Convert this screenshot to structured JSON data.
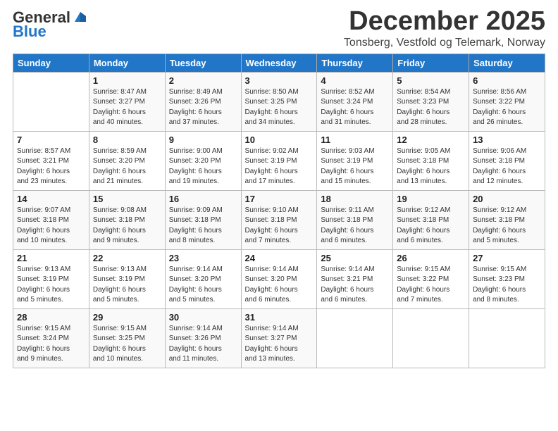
{
  "logo": {
    "general": "General",
    "blue": "Blue"
  },
  "header": {
    "month": "December 2025",
    "location": "Tonsberg, Vestfold og Telemark, Norway"
  },
  "weekdays": [
    "Sunday",
    "Monday",
    "Tuesday",
    "Wednesday",
    "Thursday",
    "Friday",
    "Saturday"
  ],
  "weeks": [
    [
      {
        "day": "",
        "info": ""
      },
      {
        "day": "1",
        "info": "Sunrise: 8:47 AM\nSunset: 3:27 PM\nDaylight: 6 hours\nand 40 minutes."
      },
      {
        "day": "2",
        "info": "Sunrise: 8:49 AM\nSunset: 3:26 PM\nDaylight: 6 hours\nand 37 minutes."
      },
      {
        "day": "3",
        "info": "Sunrise: 8:50 AM\nSunset: 3:25 PM\nDaylight: 6 hours\nand 34 minutes."
      },
      {
        "day": "4",
        "info": "Sunrise: 8:52 AM\nSunset: 3:24 PM\nDaylight: 6 hours\nand 31 minutes."
      },
      {
        "day": "5",
        "info": "Sunrise: 8:54 AM\nSunset: 3:23 PM\nDaylight: 6 hours\nand 28 minutes."
      },
      {
        "day": "6",
        "info": "Sunrise: 8:56 AM\nSunset: 3:22 PM\nDaylight: 6 hours\nand 26 minutes."
      }
    ],
    [
      {
        "day": "7",
        "info": "Sunrise: 8:57 AM\nSunset: 3:21 PM\nDaylight: 6 hours\nand 23 minutes."
      },
      {
        "day": "8",
        "info": "Sunrise: 8:59 AM\nSunset: 3:20 PM\nDaylight: 6 hours\nand 21 minutes."
      },
      {
        "day": "9",
        "info": "Sunrise: 9:00 AM\nSunset: 3:20 PM\nDaylight: 6 hours\nand 19 minutes."
      },
      {
        "day": "10",
        "info": "Sunrise: 9:02 AM\nSunset: 3:19 PM\nDaylight: 6 hours\nand 17 minutes."
      },
      {
        "day": "11",
        "info": "Sunrise: 9:03 AM\nSunset: 3:19 PM\nDaylight: 6 hours\nand 15 minutes."
      },
      {
        "day": "12",
        "info": "Sunrise: 9:05 AM\nSunset: 3:18 PM\nDaylight: 6 hours\nand 13 minutes."
      },
      {
        "day": "13",
        "info": "Sunrise: 9:06 AM\nSunset: 3:18 PM\nDaylight: 6 hours\nand 12 minutes."
      }
    ],
    [
      {
        "day": "14",
        "info": "Sunrise: 9:07 AM\nSunset: 3:18 PM\nDaylight: 6 hours\nand 10 minutes."
      },
      {
        "day": "15",
        "info": "Sunrise: 9:08 AM\nSunset: 3:18 PM\nDaylight: 6 hours\nand 9 minutes."
      },
      {
        "day": "16",
        "info": "Sunrise: 9:09 AM\nSunset: 3:18 PM\nDaylight: 6 hours\nand 8 minutes."
      },
      {
        "day": "17",
        "info": "Sunrise: 9:10 AM\nSunset: 3:18 PM\nDaylight: 6 hours\nand 7 minutes."
      },
      {
        "day": "18",
        "info": "Sunrise: 9:11 AM\nSunset: 3:18 PM\nDaylight: 6 hours\nand 6 minutes."
      },
      {
        "day": "19",
        "info": "Sunrise: 9:12 AM\nSunset: 3:18 PM\nDaylight: 6 hours\nand 6 minutes."
      },
      {
        "day": "20",
        "info": "Sunrise: 9:12 AM\nSunset: 3:18 PM\nDaylight: 6 hours\nand 5 minutes."
      }
    ],
    [
      {
        "day": "21",
        "info": "Sunrise: 9:13 AM\nSunset: 3:19 PM\nDaylight: 6 hours\nand 5 minutes."
      },
      {
        "day": "22",
        "info": "Sunrise: 9:13 AM\nSunset: 3:19 PM\nDaylight: 6 hours\nand 5 minutes."
      },
      {
        "day": "23",
        "info": "Sunrise: 9:14 AM\nSunset: 3:20 PM\nDaylight: 6 hours\nand 5 minutes."
      },
      {
        "day": "24",
        "info": "Sunrise: 9:14 AM\nSunset: 3:20 PM\nDaylight: 6 hours\nand 6 minutes."
      },
      {
        "day": "25",
        "info": "Sunrise: 9:14 AM\nSunset: 3:21 PM\nDaylight: 6 hours\nand 6 minutes."
      },
      {
        "day": "26",
        "info": "Sunrise: 9:15 AM\nSunset: 3:22 PM\nDaylight: 6 hours\nand 7 minutes."
      },
      {
        "day": "27",
        "info": "Sunrise: 9:15 AM\nSunset: 3:23 PM\nDaylight: 6 hours\nand 8 minutes."
      }
    ],
    [
      {
        "day": "28",
        "info": "Sunrise: 9:15 AM\nSunset: 3:24 PM\nDaylight: 6 hours\nand 9 minutes."
      },
      {
        "day": "29",
        "info": "Sunrise: 9:15 AM\nSunset: 3:25 PM\nDaylight: 6 hours\nand 10 minutes."
      },
      {
        "day": "30",
        "info": "Sunrise: 9:14 AM\nSunset: 3:26 PM\nDaylight: 6 hours\nand 11 minutes."
      },
      {
        "day": "31",
        "info": "Sunrise: 9:14 AM\nSunset: 3:27 PM\nDaylight: 6 hours\nand 13 minutes."
      },
      {
        "day": "",
        "info": ""
      },
      {
        "day": "",
        "info": ""
      },
      {
        "day": "",
        "info": ""
      }
    ]
  ]
}
